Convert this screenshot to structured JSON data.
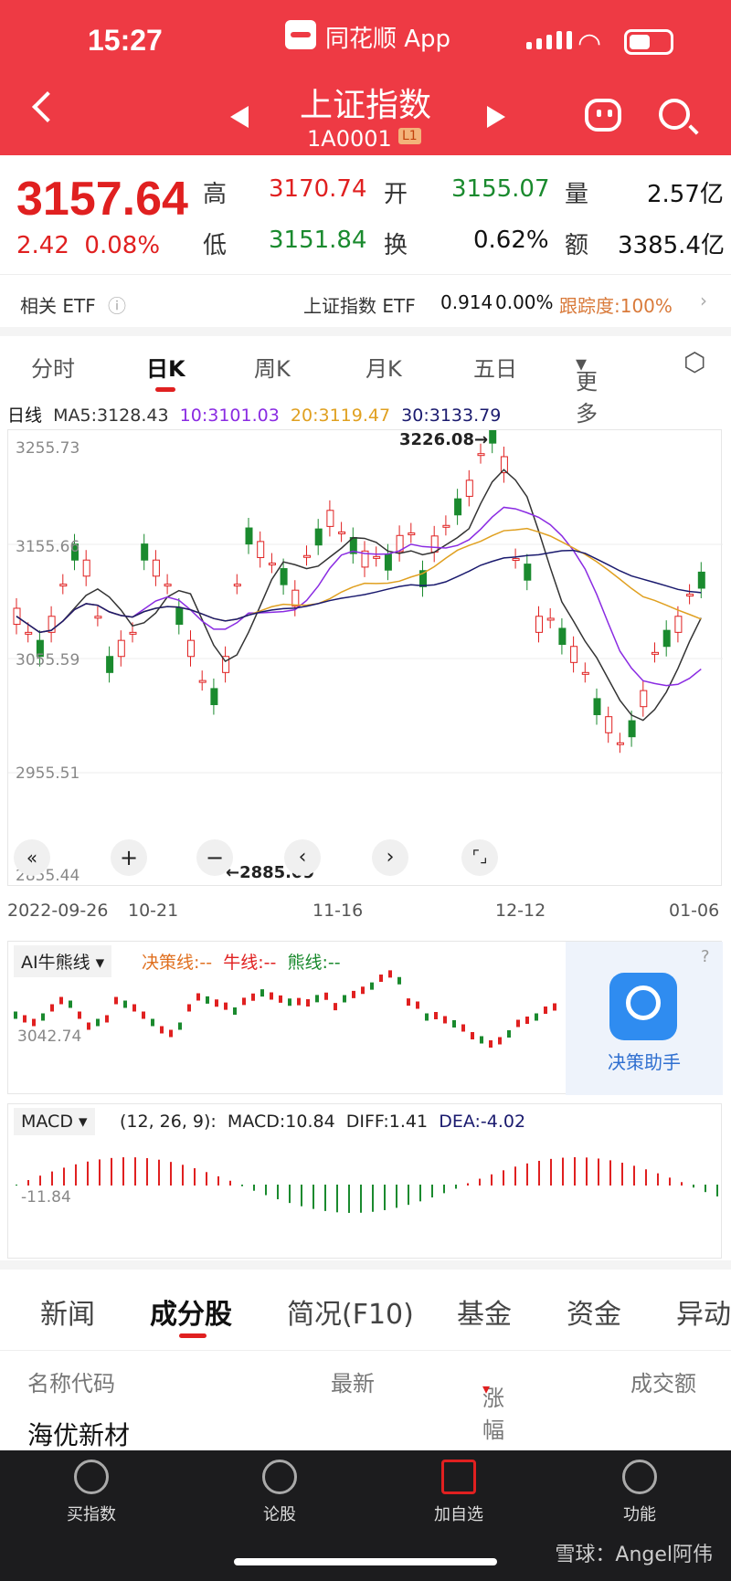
{
  "status": {
    "time": "15:27",
    "app": "同花顺 App"
  },
  "header": {
    "title": "上证指数",
    "code": "1A0001",
    "badge": "L1"
  },
  "quote": {
    "price": "3157.64",
    "change": "2.42",
    "change_pct": "0.08%",
    "high_label": "高",
    "high": "3170.74",
    "open_label": "开",
    "open": "3155.07",
    "vol_label": "量",
    "vol": "2.57亿",
    "low_label": "低",
    "low": "3151.84",
    "turn_label": "换",
    "turn": "0.62%",
    "amt_label": "额",
    "amt": "3385.4亿"
  },
  "etf": {
    "label": "相关 ETF",
    "name": "上证指数 ETF",
    "price": "0.914",
    "pct": "0.00%",
    "track": "跟踪度:100%"
  },
  "tabs": [
    "分时",
    "日K",
    "周K",
    "月K",
    "五日",
    "更多"
  ],
  "ma": {
    "label": "日线",
    "ma5": "MA5:3128.43",
    "ma10": "10:3101.03",
    "ma20": "20:3119.47",
    "ma30": "30:3133.79"
  },
  "chart": {
    "y_labels": [
      "3255.73",
      "3155.66",
      "3055.59",
      "2955.51",
      "2855.44"
    ],
    "high_mark": "3226.08→",
    "low_mark": "←2885.09",
    "dates": [
      "2022-09-26",
      "10-21",
      "11-16",
      "12-12",
      "01-06"
    ]
  },
  "ai": {
    "label": "AI牛熊线",
    "decision": "决策线:--",
    "bull": "牛线:--",
    "bear": "熊线:--",
    "axis": "3042.74",
    "assist": "决策助手"
  },
  "macd": {
    "label": "MACD",
    "params": "(12, 26, 9):",
    "macd": "MACD:10.84",
    "diff": "DIFF:1.41",
    "dea": "DEA:-4.02",
    "axis": "-11.84"
  },
  "sections": [
    "新闻",
    "成分股",
    "简况(F10)",
    "基金",
    "资金",
    "异动"
  ],
  "table": {
    "h_name": "名称代码",
    "h_last": "最新",
    "h_pct": "涨幅",
    "h_amt": "成交额",
    "row_name": "海优新材"
  },
  "bottom": [
    "买指数",
    "论股",
    "加自选",
    "功能"
  ],
  "watermark": "雪球：Angel阿伟",
  "colors": {
    "brand": "#ee3a44",
    "up": "#e02020",
    "down": "#1a8a2e"
  }
}
